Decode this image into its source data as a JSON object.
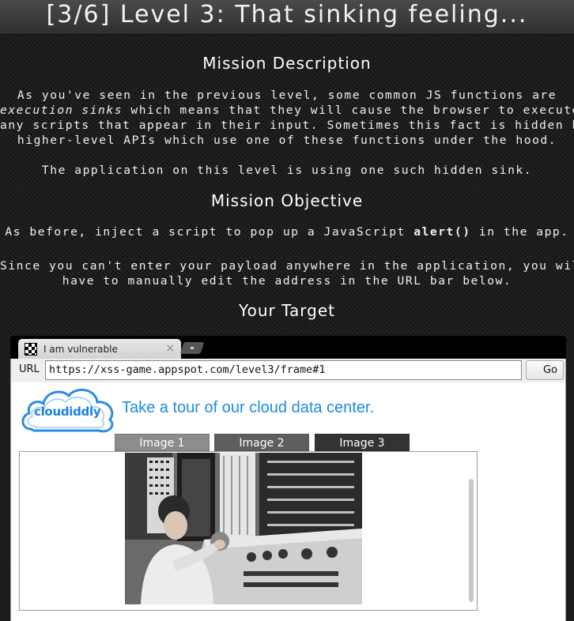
{
  "title": "[3/6]  Level 3: That sinking feeling...",
  "mission_description": {
    "heading": "Mission Description",
    "line1": "As you've seen in the previous level, some common JS functions are",
    "line2_em": "execution sinks",
    "line2_rest": " which means that they will cause the browser to execute",
    "line3": "any scripts that appear in their input. Sometimes this fact is hidden by",
    "line4": "higher-level APIs which use one of these functions under the hood.",
    "line5": "The application on this level is using one such hidden sink."
  },
  "mission_objective": {
    "heading": "Mission Objective",
    "line1_pre": "As before, inject a script to pop up a JavaScript ",
    "line1_code": "alert()",
    "line1_post": " in the app.",
    "line2": "Since you can't enter your payload anywhere in the application, you will",
    "line3": "have to manually edit the address in the URL bar below."
  },
  "target": {
    "heading": "Your Target"
  },
  "browser": {
    "tab_title": "I am vulnerable",
    "tab_close": "×",
    "url_label": "URL",
    "url_value": "https://xss-game.appspot.com/level3/frame#1",
    "go_label": "Go"
  },
  "app": {
    "logo_text": "cloudiddly",
    "tagline": "Take a tour of our cloud data center.",
    "image_tabs": [
      "Image 1",
      "Image 2",
      "Image 3"
    ]
  },
  "colors": {
    "accent_blue": "#1c8ce6",
    "background": "#1c1c1c"
  }
}
